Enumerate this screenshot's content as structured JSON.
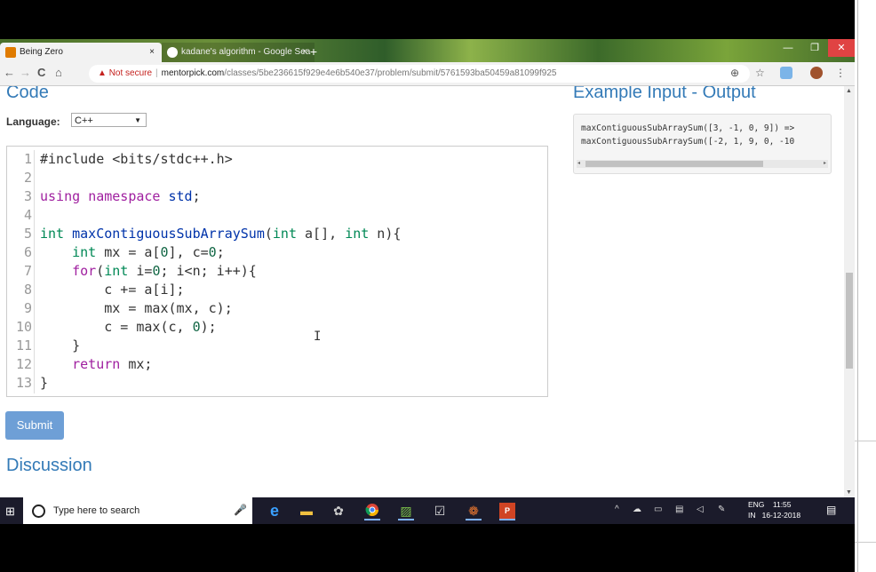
{
  "browser": {
    "tabs": [
      {
        "title": "Being Zero",
        "close": "×",
        "active": true,
        "icon_color": "#e07b00"
      },
      {
        "title": "kadane's algorithm - Google Sea",
        "close": "×",
        "active": false,
        "icon_color": "#4285f4"
      }
    ],
    "new_tab": "+",
    "window_controls": {
      "minimize": "—",
      "restore": "❐",
      "close": "✕"
    },
    "nav": {
      "back": "←",
      "forward": "→",
      "reload": "C",
      "home": "⌂"
    },
    "address": {
      "warning_icon": "▲",
      "security_text": "Not secure",
      "host": "mentorpick.com",
      "path": "/classes/5be236615f929e4e6b540e37/problem/submit/5761593ba50459a81099f925"
    },
    "toolbar_icons": {
      "zoom": "⊕",
      "star": "☆"
    }
  },
  "page": {
    "code_heading": "Code",
    "language_label": "Language:",
    "language_value": "C++",
    "language_arrow": "▼",
    "editor": {
      "line_numbers": [
        "1",
        "2",
        "3",
        "4",
        "5",
        "6",
        "7",
        "8",
        "9",
        "10",
        "11",
        "12",
        "13"
      ]
    },
    "submit_label": "Submit",
    "discussion_heading": "Discussion",
    "example_heading": "Example Input - Output",
    "example_lines": [
      "maxContiguousSubArraySum([3, -1, 0, 9]) =>",
      "maxContiguousSubArraySum([-2, 1, 9, 0, -10"
    ],
    "example_scroll": {
      "left": "◂",
      "right": "▸"
    }
  },
  "scrollbar": {
    "up": "▲",
    "down": "▼"
  },
  "taskbar": {
    "search_placeholder": "Type here to search",
    "mic": "🎙",
    "lang_top": "ENG",
    "lang_bottom": "IN",
    "time": "11:55",
    "date": "16-12-2018",
    "tray_chevron": "^"
  }
}
